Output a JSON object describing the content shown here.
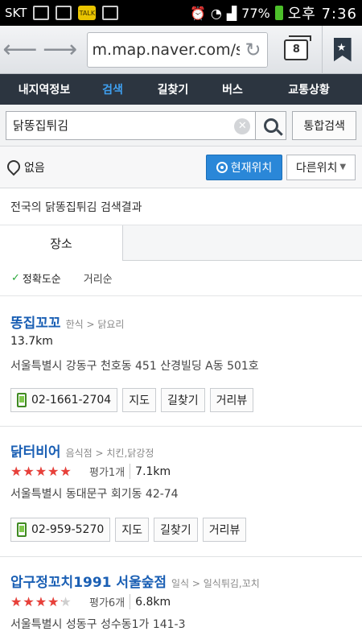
{
  "status_bar": {
    "carrier": "SKT",
    "battery": "77%",
    "time": "오후 7:36"
  },
  "browser": {
    "url": "m.map.naver.com/se",
    "tab_count": "8"
  },
  "nav": {
    "items": [
      {
        "label": "내지역정보",
        "active": false
      },
      {
        "label": "검색",
        "active": true
      },
      {
        "label": "길찾기",
        "active": false
      },
      {
        "label": "버스",
        "active": false
      },
      {
        "label": "교통상황",
        "active": false
      }
    ]
  },
  "search": {
    "value": "닭똥집튀김",
    "total_label": "통합검색"
  },
  "location": {
    "current": "없음",
    "current_button": "현재위치",
    "other_button": "다른위치"
  },
  "summary": "전국의 닭똥집튀김 검색결과",
  "tabs": {
    "place": "장소"
  },
  "sort": {
    "accuracy": "정확도순",
    "distance": "거리순"
  },
  "results": [
    {
      "name": "똥집꼬꼬",
      "category": "한식 > 닭요리",
      "distance": "13.7km",
      "address": "서울특별시 강동구 천호동 451 산경빌딩 A동 501호",
      "phone": "02-1661-2704",
      "actions": {
        "map": "지도",
        "route": "길찾기",
        "street": "거리뷰"
      }
    },
    {
      "name": "닭터비어",
      "category": "음식점 > 치킨,닭강정",
      "rating": 5,
      "rating_count": "평가1개",
      "distance": "7.1km",
      "address": "서울특별시 동대문구 회기동 42-74",
      "phone": "02-959-5270",
      "actions": {
        "map": "지도",
        "route": "길찾기",
        "street": "거리뷰"
      }
    },
    {
      "name": "압구정꼬치1991 서울숲점",
      "category": "일식 > 일식튀김,꼬치",
      "rating": 3.5,
      "rating_count": "평가6개",
      "distance": "6.8km",
      "address": "서울특별시 성동구 성수동1가 141-3"
    }
  ]
}
